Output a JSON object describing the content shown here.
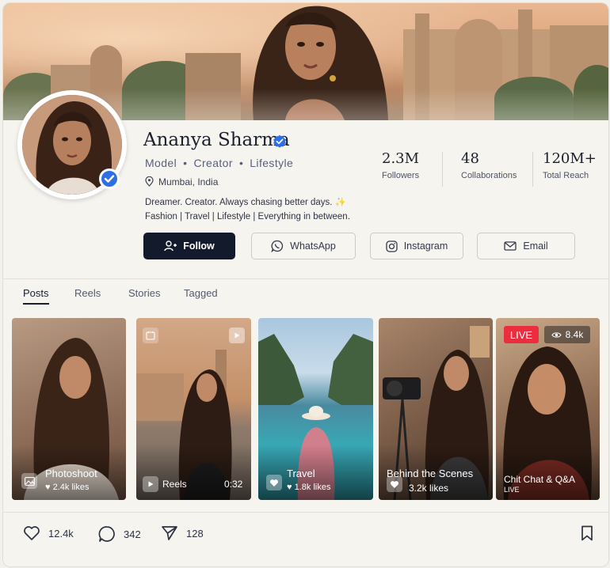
{
  "profile": {
    "name": "Ananya Sharma",
    "roles": [
      "Model",
      "Creator",
      "Lifestyle"
    ],
    "location": "Mumbai, India",
    "bio_line1": "Dreamer. Creator. Always chasing better days. ✨",
    "bio_line2": "Fashion | Travel | Lifestyle | Everything in between."
  },
  "stats": [
    {
      "value": "2.3M",
      "label": "Followers"
    },
    {
      "value": "48",
      "label": "Collaborations"
    },
    {
      "value": "120M+",
      "label": "Total Reach"
    }
  ],
  "actions": {
    "follow": "Follow",
    "whatsapp": "WhatsApp",
    "instagram": "Instagram",
    "email": "Email"
  },
  "tabs": [
    {
      "label": "Posts",
      "active": true
    },
    {
      "label": "Reels",
      "active": false
    },
    {
      "label": "Stories",
      "active": false
    },
    {
      "label": "Tagged",
      "active": false
    }
  ],
  "posts": [
    {
      "title": "Photoshoot",
      "likes": "2.4k likes",
      "icon": "image-icon"
    },
    {
      "title": "Reels",
      "duration": "0:32",
      "icon": "play-icon"
    },
    {
      "title": "Travel",
      "likes": "1.8k likes",
      "icon": "heart-icon"
    },
    {
      "title": "Behind the Scenes",
      "likes": "3.2k likes",
      "icon": "heart-icon"
    },
    {
      "title": "Chit Chat & Q&A",
      "badge": "LIVE",
      "viewers": "8.4k",
      "sub": "LIVE"
    }
  ],
  "engagement": {
    "likes": "12.4k",
    "comments": "342",
    "shares": "128"
  },
  "colors": {
    "primary_button": "#131a2c",
    "verified_blue": "#2f6fe4",
    "live_red": "#ea2d3f",
    "background": "#f6f4ef"
  }
}
